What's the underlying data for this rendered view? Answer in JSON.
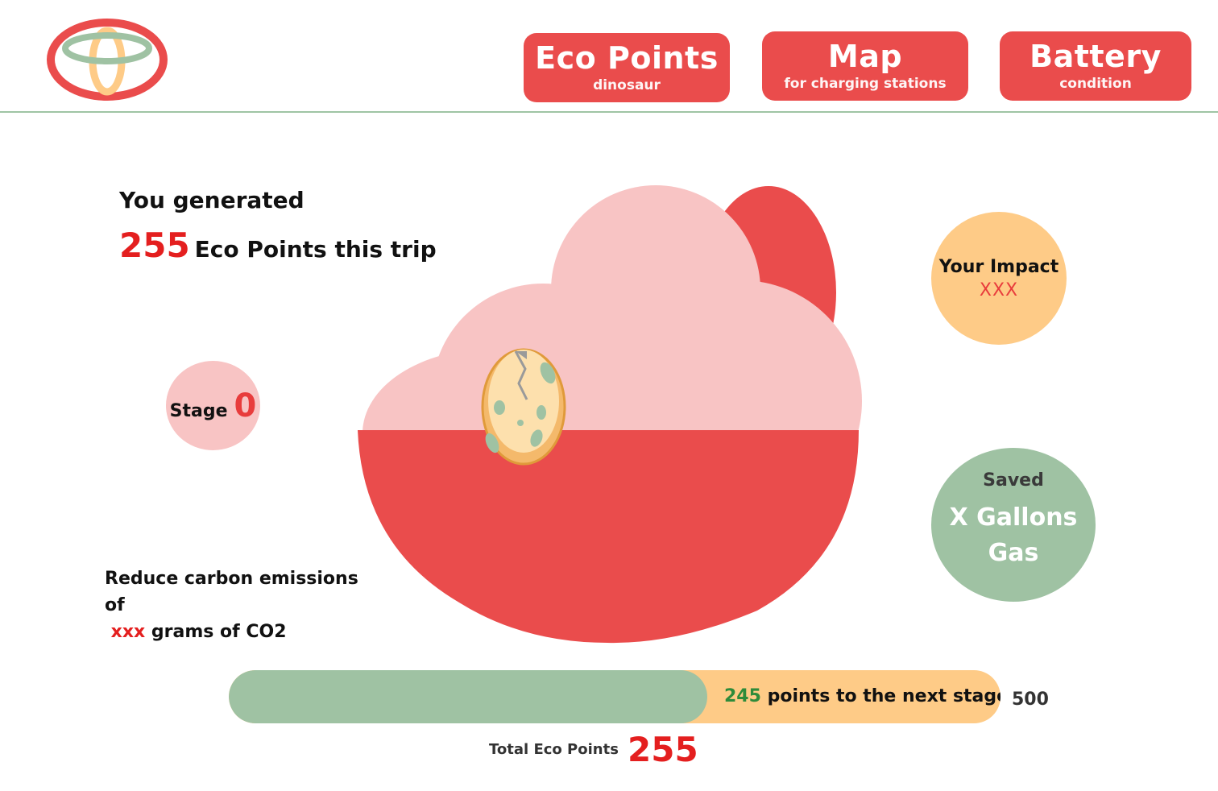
{
  "nav": [
    {
      "title": "Eco Points",
      "sub": "dinosaur"
    },
    {
      "title": "Map",
      "sub": "for charging stations"
    },
    {
      "title": "Battery",
      "sub": "condition"
    }
  ],
  "trip": {
    "generated_label": "You generated",
    "points": "255",
    "points_suffix": "Eco Points this trip"
  },
  "stage": {
    "label": "Stage",
    "value": "0"
  },
  "impact": {
    "label": "Your Impact",
    "value": "XXX"
  },
  "saved": {
    "label": "Saved",
    "value": "X Gallons Gas"
  },
  "reduce": {
    "text": "Reduce carbon emissions of",
    "amount": "xxx",
    "unit": "grams of CO2"
  },
  "progress": {
    "current": 255,
    "max_label": "500",
    "remaining": "245",
    "remaining_text": "points to the next stage",
    "fraction": 0.62
  },
  "total": {
    "label": "Total Eco Points",
    "value": "255"
  },
  "colors": {
    "primary_red": "#ea4c4c",
    "accent_red": "#e41f1f",
    "pink": "#f8c4c4",
    "orange": "#fecb87",
    "green": "#9fc2a3"
  },
  "icons": {
    "logo": "toyota-logo-icon",
    "egg": "dinosaur-egg-icon"
  }
}
